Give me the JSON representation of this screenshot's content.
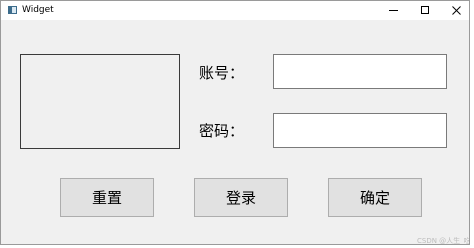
{
  "window": {
    "title": "Widget",
    "icon": "app-window-icon",
    "controls": {
      "minimize": "minimize-icon",
      "maximize": "maximize-icon",
      "close": "close-icon"
    }
  },
  "form": {
    "image_frame": "",
    "account_label": "账号：",
    "account_value": "",
    "password_label": "密码：",
    "password_value": ""
  },
  "buttons": {
    "reset_label": "重置",
    "login_label": "登录",
    "confirm_label": "确定"
  },
  "watermark": "CSDN @人生_吃"
}
